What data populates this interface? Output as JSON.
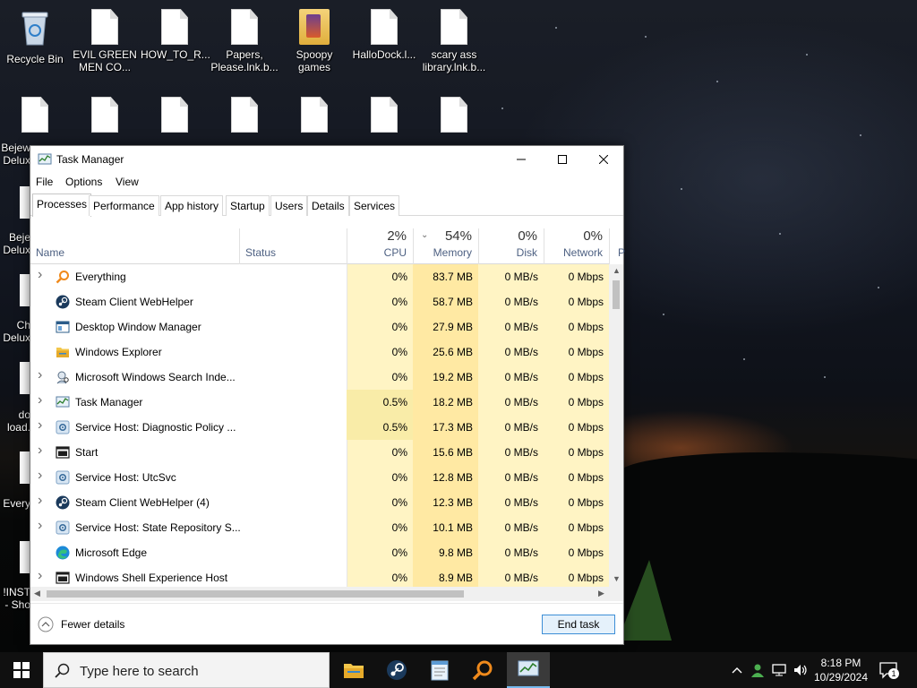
{
  "desktop": {
    "icons": [
      {
        "label": "Recycle Bin",
        "kind": "recycle-bin"
      },
      {
        "label": "EVIL GREEN MEN CO...",
        "kind": "file"
      },
      {
        "label": "HOW_TO_R...",
        "kind": "file"
      },
      {
        "label": "Papers, Please.lnk.b...",
        "kind": "file"
      },
      {
        "label": "Spoopy games",
        "kind": "folder"
      },
      {
        "label": "HalloDock.l...",
        "kind": "file"
      },
      {
        "label": "scary ass library.lnk.b...",
        "kind": "file"
      }
    ],
    "side_labels": [
      {
        "label": "Bejew Delux"
      },
      {
        "label": "Beje Delux"
      },
      {
        "label": "Ch Delux"
      },
      {
        "label": "do load."
      },
      {
        "label": "Every"
      },
      {
        "label": "!INST - Sho"
      }
    ]
  },
  "window": {
    "title": "Task Manager",
    "menu": [
      "File",
      "Options",
      "View"
    ],
    "tabs": [
      "Processes",
      "Performance",
      "App history",
      "Startup",
      "Users",
      "Details",
      "Services"
    ],
    "active_tab": "Processes",
    "columns": {
      "name": "Name",
      "status": "Status",
      "cpu": {
        "pct": "2%",
        "label": "CPU"
      },
      "memory": {
        "pct": "54%",
        "label": "Memory"
      },
      "disk": {
        "pct": "0%",
        "label": "Disk"
      },
      "network": {
        "pct": "0%",
        "label": "Network"
      },
      "power": {
        "label": "P"
      }
    },
    "processes": [
      {
        "name": "Everything",
        "expandable": true,
        "icon": "magnifier-icon",
        "cpu": "0%",
        "memory": "83.7 MB",
        "disk": "0 MB/s",
        "network": "0 Mbps"
      },
      {
        "name": "Steam Client WebHelper",
        "expandable": false,
        "icon": "steam-icon",
        "cpu": "0%",
        "memory": "58.7 MB",
        "disk": "0 MB/s",
        "network": "0 Mbps"
      },
      {
        "name": "Desktop Window Manager",
        "expandable": false,
        "icon": "window-icon",
        "cpu": "0%",
        "memory": "27.9 MB",
        "disk": "0 MB/s",
        "network": "0 Mbps"
      },
      {
        "name": "Windows Explorer",
        "expandable": false,
        "icon": "folder-icon",
        "cpu": "0%",
        "memory": "25.6 MB",
        "disk": "0 MB/s",
        "network": "0 Mbps"
      },
      {
        "name": "Microsoft Windows Search Inde...",
        "expandable": true,
        "icon": "search-indexer-icon",
        "cpu": "0%",
        "memory": "19.2 MB",
        "disk": "0 MB/s",
        "network": "0 Mbps"
      },
      {
        "name": "Task Manager",
        "expandable": true,
        "icon": "task-manager-icon",
        "cpu": "0.5%",
        "memory": "18.2 MB",
        "disk": "0 MB/s",
        "network": "0 Mbps"
      },
      {
        "name": "Service Host: Diagnostic Policy ...",
        "expandable": true,
        "icon": "gear-icon",
        "cpu": "0.5%",
        "memory": "17.3 MB",
        "disk": "0 MB/s",
        "network": "0 Mbps"
      },
      {
        "name": "Start",
        "expandable": true,
        "icon": "start-window-icon",
        "cpu": "0%",
        "memory": "15.6 MB",
        "disk": "0 MB/s",
        "network": "0 Mbps"
      },
      {
        "name": "Service Host: UtcSvc",
        "expandable": true,
        "icon": "gear-icon",
        "cpu": "0%",
        "memory": "12.8 MB",
        "disk": "0 MB/s",
        "network": "0 Mbps"
      },
      {
        "name": "Steam Client WebHelper (4)",
        "expandable": true,
        "icon": "steam-icon",
        "cpu": "0%",
        "memory": "12.3 MB",
        "disk": "0 MB/s",
        "network": "0 Mbps"
      },
      {
        "name": "Service Host: State Repository S...",
        "expandable": true,
        "icon": "gear-icon",
        "cpu": "0%",
        "memory": "10.1 MB",
        "disk": "0 MB/s",
        "network": "0 Mbps"
      },
      {
        "name": "Microsoft Edge",
        "expandable": false,
        "icon": "edge-icon",
        "cpu": "0%",
        "memory": "9.8 MB",
        "disk": "0 MB/s",
        "network": "0 Mbps"
      },
      {
        "name": "Windows Shell Experience Host",
        "expandable": true,
        "icon": "start-window-icon",
        "cpu": "0%",
        "memory": "8.9 MB",
        "disk": "0 MB/s",
        "network": "0 Mbps"
      }
    ],
    "footer": {
      "fewer_details": "Fewer details",
      "end_task": "End task"
    }
  },
  "taskbar": {
    "search_placeholder": "Type here to search",
    "apps": [
      "file-explorer-icon",
      "steam-icon",
      "notepad-icon",
      "everything-icon",
      "task-manager-icon"
    ],
    "clock": {
      "time": "8:18 PM",
      "date": "10/29/2024"
    },
    "notifications_count": "1"
  },
  "colors": {
    "cpu_heat": "#f9eca8",
    "col_bg": "#fff4c4",
    "accent": "#0078d7"
  }
}
